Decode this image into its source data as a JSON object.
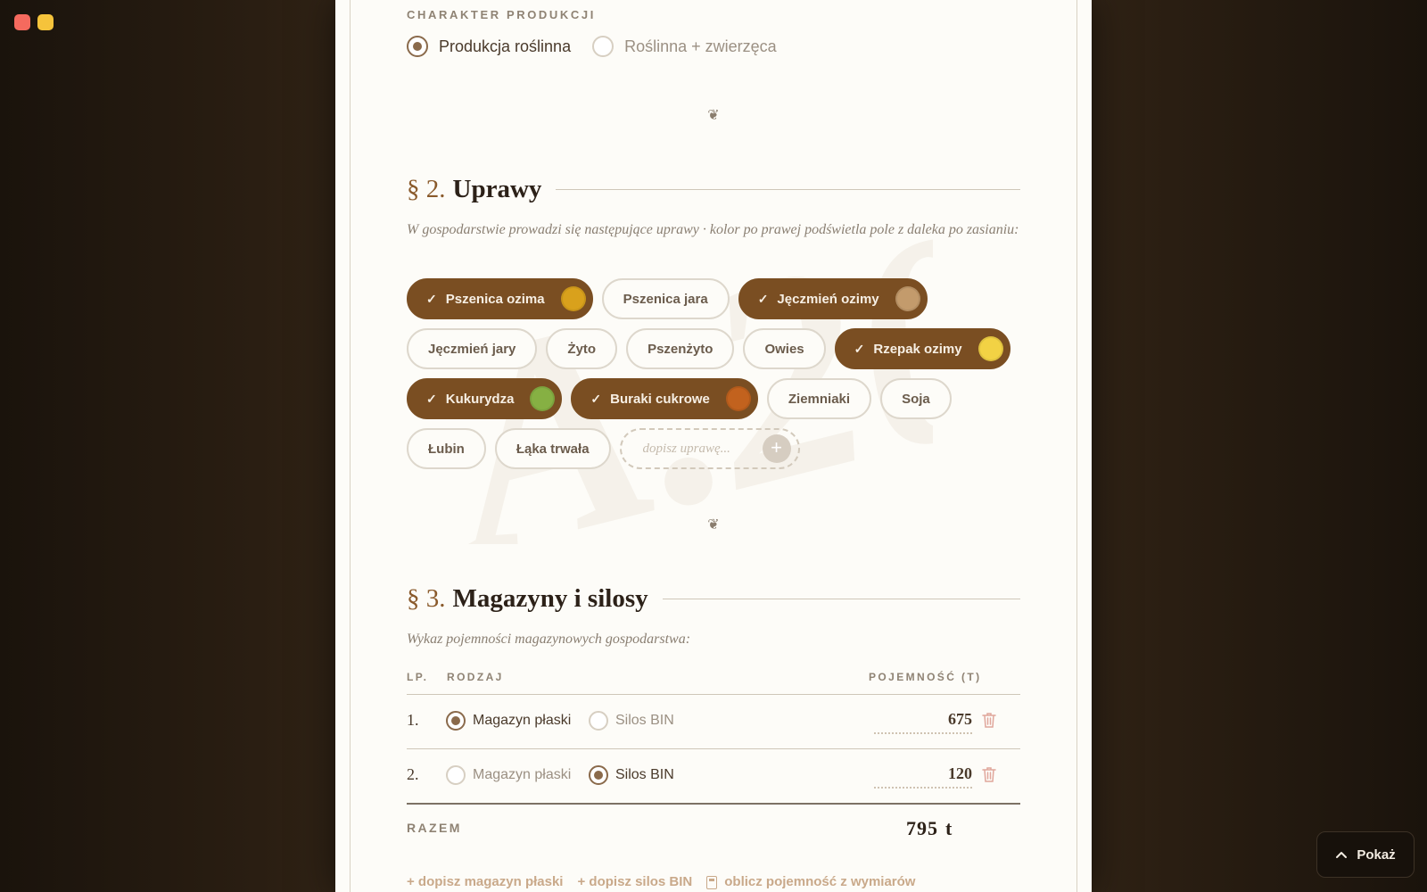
{
  "window": {
    "controls": [
      "close",
      "minimize"
    ]
  },
  "production": {
    "kicker": "CHARAKTER PRODUKCJI",
    "options": [
      {
        "label": "Produkcja roślinna",
        "selected": true
      },
      {
        "label": "Roślinna + zwierzęca",
        "selected": false
      }
    ]
  },
  "fleuron": "❦",
  "watermark_text": "A.20",
  "section2": {
    "num": "§ 2.",
    "title": "Uprawy",
    "lead": "W gospodarstwie prowadzi się następujące uprawy · kolor po prawej podświetla pole z daleka po zasianiu:",
    "check_symbol": "✓",
    "crops": [
      {
        "label": "Pszenica ozima",
        "selected": true,
        "color": "#d9a11c"
      },
      {
        "label": "Pszenica jara",
        "selected": false
      },
      {
        "label": "Jęczmień ozimy",
        "selected": true,
        "color": "#c39b6c"
      },
      {
        "label": "Jęczmień jary",
        "selected": false
      },
      {
        "label": "Żyto",
        "selected": false
      },
      {
        "label": "Pszenżyto",
        "selected": false
      },
      {
        "label": "Owies",
        "selected": false
      },
      {
        "label": "Rzepak ozimy",
        "selected": true,
        "color": "#f2d244"
      },
      {
        "label": "Kukurydza",
        "selected": true,
        "color": "#86b043"
      },
      {
        "label": "Buraki cukrowe",
        "selected": true,
        "color": "#c2621e"
      },
      {
        "label": "Ziemniaki",
        "selected": false
      },
      {
        "label": "Soja",
        "selected": false
      },
      {
        "label": "Łubin",
        "selected": false
      },
      {
        "label": "Łąka trwała",
        "selected": false
      }
    ],
    "add_placeholder": "dopisz uprawę...",
    "add_symbol": "+"
  },
  "section3": {
    "num": "§ 3.",
    "title": "Magazyny i silosy",
    "lead": "Wykaz pojemności magazynowych gospodarstwa:",
    "headers": {
      "lp": "LP.",
      "type": "RODZAJ",
      "capacity": "POJEMNOŚĆ (T)"
    },
    "type_options": [
      "Magazyn płaski",
      "Silos BIN"
    ],
    "rows": [
      {
        "lp": "1.",
        "selected_type": 0,
        "capacity": "675"
      },
      {
        "lp": "2.",
        "selected_type": 1,
        "capacity": "120"
      }
    ],
    "total_label": "RAZEM",
    "total_value": "795",
    "total_unit": "t",
    "actions": {
      "add_flat": "+ dopisz magazyn płaski",
      "add_bin": "+ dopisz silos BIN",
      "calc": "oblicz pojemność z wymiarów"
    }
  },
  "show_button": {
    "label": "Pokaż",
    "icon": "chevron-up-icon"
  },
  "colors": {
    "accent": "#7a4e22",
    "paper": "#fdfcf8",
    "backdrop": "#2f2215"
  }
}
